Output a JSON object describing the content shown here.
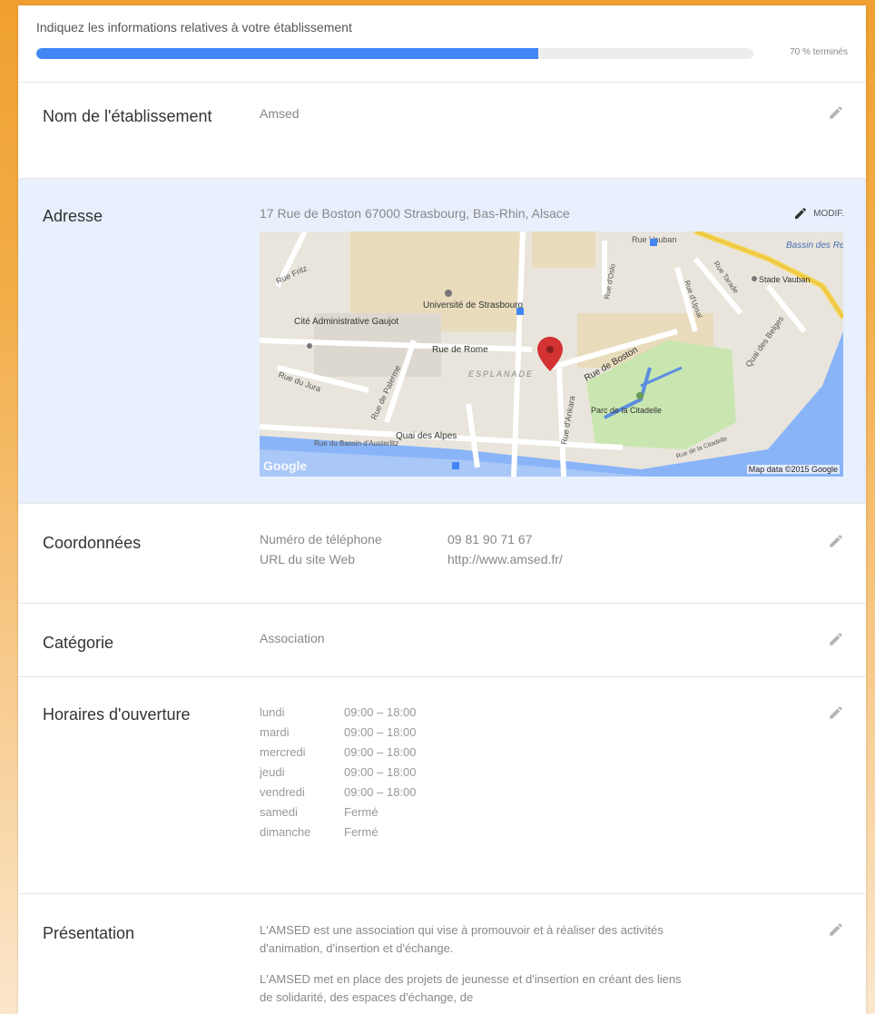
{
  "progress": {
    "title": "Indiquez les informations relatives à votre établissement",
    "fraction": 0.7,
    "label": "70 % terminés",
    "color": "#4285f4"
  },
  "sections": {
    "name": {
      "label": "Nom de l'établissement",
      "value": "Amsed"
    },
    "address": {
      "label": "Adresse",
      "value": "17 Rue de Boston 67000 Strasbourg, Bas-Rhin, Alsace",
      "edit_label": "MODIF.",
      "map": {
        "credit": "Map data ©2015 Google",
        "logo": "Google",
        "places": {
          "vauban_street": "Rue Vauban",
          "bassin": "Bassin des Remparts",
          "stade": "Stade Vauban",
          "fritz": "Rue Fritz",
          "universite": "Université de Strasbourg",
          "cite": "Cité Administrative Gaujot",
          "rome": "Rue de Rome",
          "esplanade": "ESPLANADE",
          "boston": "Rue de Boston",
          "jura": "Rue du Jura",
          "palerme": "Rue de Palerme",
          "ankara": "Rue d'Ankara",
          "parc": "Parc de la Citadelle",
          "quai_alpes": "Quai des Alpes",
          "bassin_austerlitz": "Rue du Bassin d'Austerlitz",
          "oslo": "Rue d'Oslo",
          "upsal": "Rue d'Upsal",
          "tarade": "Rue Tarade",
          "quai_belges": "Quai des Belges",
          "citadelle_rue": "Rue de la Citadelle"
        }
      }
    },
    "contact": {
      "label": "Coordonnées",
      "rows": [
        {
          "key": "Numéro de téléphone",
          "value": "09 81 90 71 67"
        },
        {
          "key": "URL du site Web",
          "value": "http://www.amsed.fr/"
        }
      ]
    },
    "category": {
      "label": "Catégorie",
      "value": "Association"
    },
    "hours": {
      "label": "Horaires d'ouverture",
      "rows": [
        {
          "day": "lundi",
          "time": "09:00 – 18:00"
        },
        {
          "day": "mardi",
          "time": "09:00 – 18:00"
        },
        {
          "day": "mercredi",
          "time": "09:00 – 18:00"
        },
        {
          "day": "jeudi",
          "time": "09:00 – 18:00"
        },
        {
          "day": "vendredi",
          "time": "09:00 – 18:00"
        },
        {
          "day": "samedi",
          "time": "Fermé"
        },
        {
          "day": "dimanche",
          "time": "Fermé"
        }
      ]
    },
    "presentation": {
      "label": "Présentation",
      "paragraphs": [
        "L'AMSED est une association qui vise à promouvoir et à réaliser des activités d'animation, d'insertion et d'échange.",
        "L'AMSED met en place des projets de jeunesse et d'insertion en créant des liens de solidarité, des espaces d'échange, de"
      ]
    }
  },
  "icons": {
    "edit": "pencil-icon",
    "pin": "map-pin-icon"
  }
}
